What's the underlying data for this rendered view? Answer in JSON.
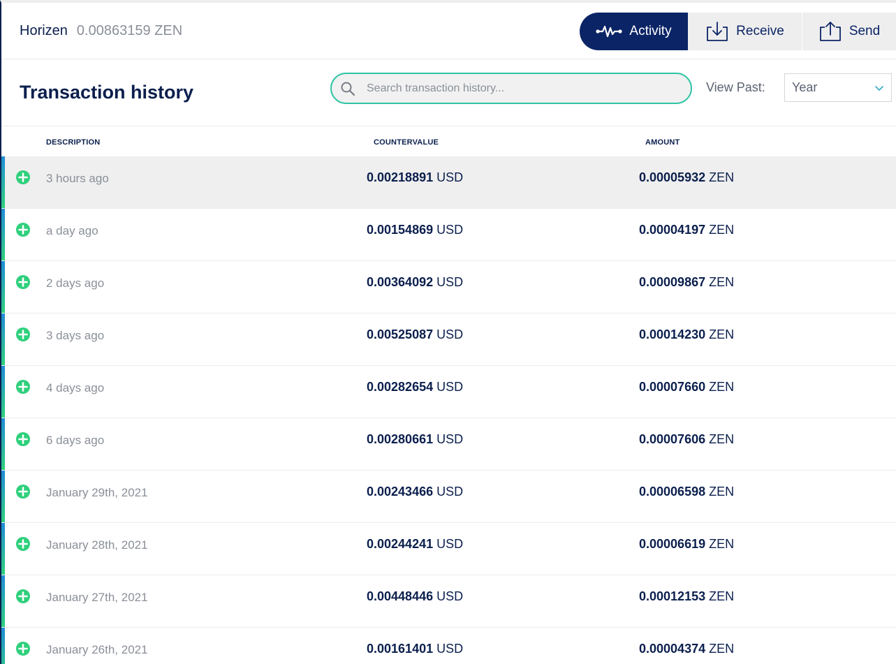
{
  "header": {
    "wallet_name": "Horizen",
    "wallet_balance": "0.00863159 ZEN",
    "actions": {
      "activity": "Activity",
      "receive": "Receive",
      "send": "Send"
    }
  },
  "history": {
    "title": "Transaction history",
    "search_placeholder": "Search transaction history...",
    "view_past_label": "View Past:",
    "view_past_value": "Year"
  },
  "table": {
    "columns": {
      "description": "DESCRIPTION",
      "countervalue": "COUNTERVALUE",
      "amount": "AMOUNT"
    },
    "rows": [
      {
        "description": "3 hours ago",
        "countervalue": "0.00218891",
        "countervalue_unit": "USD",
        "amount": "0.00005932",
        "amount_unit": "ZEN"
      },
      {
        "description": "a day ago",
        "countervalue": "0.00154869",
        "countervalue_unit": "USD",
        "amount": "0.00004197",
        "amount_unit": "ZEN"
      },
      {
        "description": "2 days ago",
        "countervalue": "0.00364092",
        "countervalue_unit": "USD",
        "amount": "0.00009867",
        "amount_unit": "ZEN"
      },
      {
        "description": "3 days ago",
        "countervalue": "0.00525087",
        "countervalue_unit": "USD",
        "amount": "0.00014230",
        "amount_unit": "ZEN"
      },
      {
        "description": "4 days ago",
        "countervalue": "0.00282654",
        "countervalue_unit": "USD",
        "amount": "0.00007660",
        "amount_unit": "ZEN"
      },
      {
        "description": "6 days ago",
        "countervalue": "0.00280661",
        "countervalue_unit": "USD",
        "amount": "0.00007606",
        "amount_unit": "ZEN"
      },
      {
        "description": "January 29th, 2021",
        "countervalue": "0.00243466",
        "countervalue_unit": "USD",
        "amount": "0.00006598",
        "amount_unit": "ZEN"
      },
      {
        "description": "January 28th, 2021",
        "countervalue": "0.00244241",
        "countervalue_unit": "USD",
        "amount": "0.00006619",
        "amount_unit": "ZEN"
      },
      {
        "description": "January 27th, 2021",
        "countervalue": "0.00448446",
        "countervalue_unit": "USD",
        "amount": "0.00012153",
        "amount_unit": "ZEN"
      },
      {
        "description": "January 26th, 2021",
        "countervalue": "0.00161401",
        "countervalue_unit": "USD",
        "amount": "0.00004374",
        "amount_unit": "ZEN"
      }
    ]
  },
  "icons": {
    "activity": "activity-pulse-icon",
    "receive": "download-icon",
    "send": "upload-icon",
    "search": "search-icon",
    "select": "chevron-down-icon",
    "row": "plus-circle-icon"
  },
  "colors": {
    "navy": "#0b2466",
    "accent_teal": "#2fc4a4",
    "incoming_green": "#2fd07c",
    "muted_text": "#8a8f98"
  }
}
